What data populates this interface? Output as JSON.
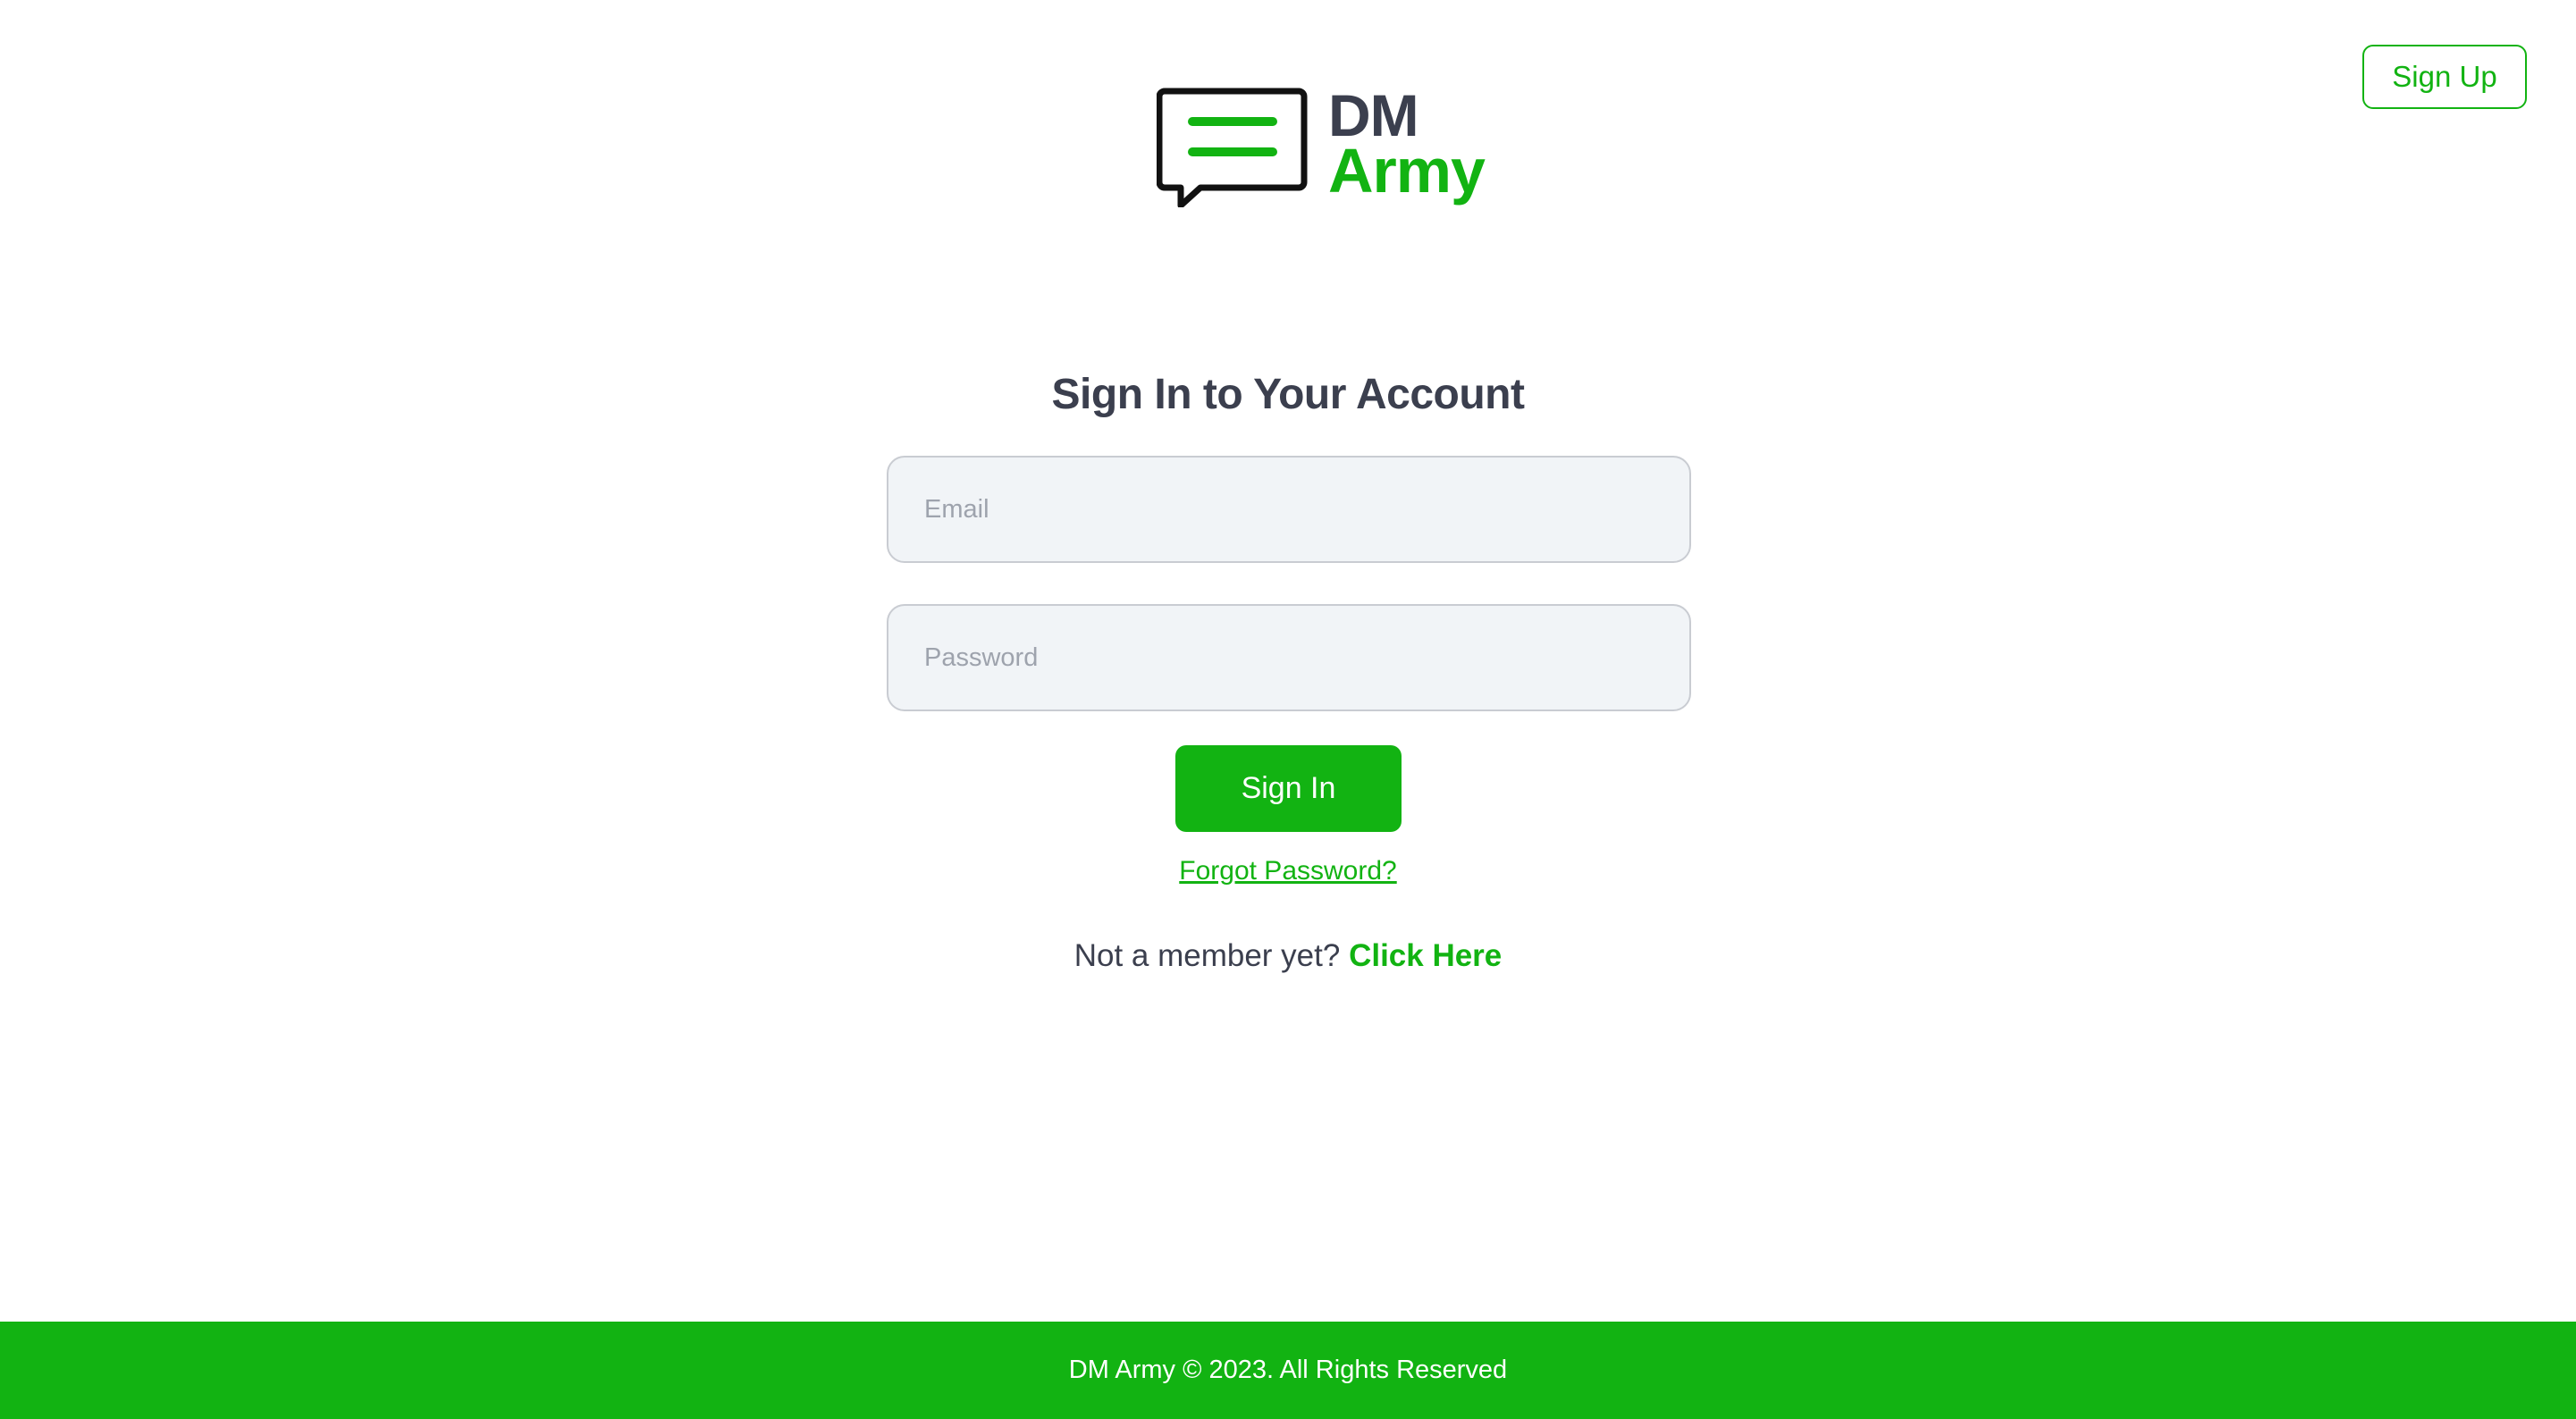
{
  "header": {
    "signup_label": "Sign Up"
  },
  "logo": {
    "line1": "DM",
    "line2": "Army",
    "icon": "chat-bubble-icon"
  },
  "signin": {
    "title": "Sign In to Your Account",
    "email": {
      "placeholder": "Email",
      "value": ""
    },
    "password": {
      "placeholder": "Password",
      "value": ""
    },
    "submit_label": "Sign In",
    "forgot_label": "Forgot Password?",
    "member_prompt": "Not a member yet?",
    "member_link": "Click Here"
  },
  "footer": {
    "text": "DM Army © 2023. All Rights Reserved"
  },
  "colors": {
    "accent": "#12b312",
    "text": "#3b3f4e",
    "input_bg": "#f1f4f7",
    "input_border": "#c9ccd2"
  }
}
